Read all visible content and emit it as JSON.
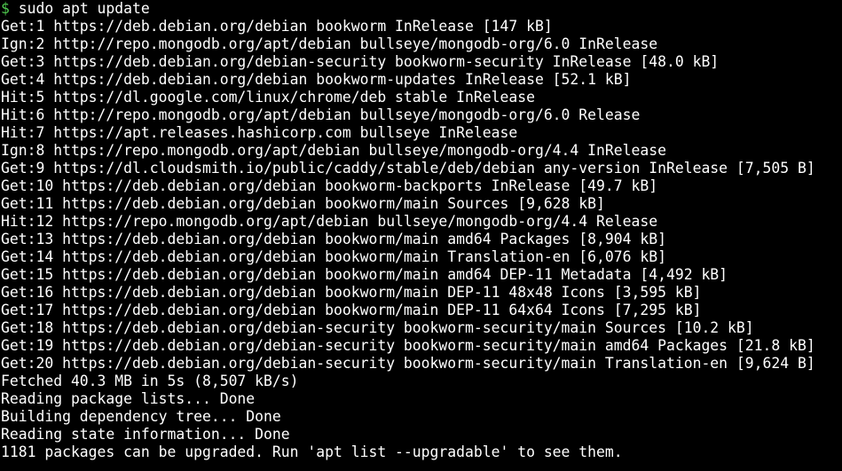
{
  "terminal": {
    "prompt_symbol": "$",
    "prompt_symbol_color": "#4ec94e",
    "command": " sudo apt update",
    "lines": [
      "Get:1 https://deb.debian.org/debian bookworm InRelease [147 kB]",
      "Ign:2 http://repo.mongodb.org/apt/debian bullseye/mongodb-org/6.0 InRelease",
      "Get:3 https://deb.debian.org/debian-security bookworm-security InRelease [48.0 kB]",
      "Get:4 https://deb.debian.org/debian bookworm-updates InRelease [52.1 kB]",
      "Hit:5 https://dl.google.com/linux/chrome/deb stable InRelease",
      "Hit:6 http://repo.mongodb.org/apt/debian bullseye/mongodb-org/6.0 Release",
      "Hit:7 https://apt.releases.hashicorp.com bullseye InRelease",
      "Ign:8 https://repo.mongodb.org/apt/debian bullseye/mongodb-org/4.4 InRelease",
      "Get:9 https://dl.cloudsmith.io/public/caddy/stable/deb/debian any-version InRelease [7,505 B]",
      "Get:10 https://deb.debian.org/debian bookworm-backports InRelease [49.7 kB]",
      "Get:11 https://deb.debian.org/debian bookworm/main Sources [9,628 kB]",
      "Hit:12 https://repo.mongodb.org/apt/debian bullseye/mongodb-org/4.4 Release",
      "Get:13 https://deb.debian.org/debian bookworm/main amd64 Packages [8,904 kB]",
      "Get:14 https://deb.debian.org/debian bookworm/main Translation-en [6,076 kB]",
      "Get:15 https://deb.debian.org/debian bookworm/main amd64 DEP-11 Metadata [4,492 kB]",
      "Get:16 https://deb.debian.org/debian bookworm/main DEP-11 48x48 Icons [3,595 kB]",
      "Get:17 https://deb.debian.org/debian bookworm/main DEP-11 64x64 Icons [7,295 kB]",
      "Get:18 https://deb.debian.org/debian-security bookworm-security/main Sources [10.2 kB]",
      "Get:19 https://deb.debian.org/debian-security bookworm-security/main amd64 Packages [21.8 kB]",
      "Get:20 https://deb.debian.org/debian-security bookworm-security/main Translation-en [9,624 B]",
      "Fetched 40.3 MB in 5s (8,507 kB/s)",
      "Reading package lists... Done",
      "Building dependency tree... Done",
      "Reading state information... Done",
      "1181 packages can be upgraded. Run 'apt list --upgradable' to see them."
    ]
  }
}
